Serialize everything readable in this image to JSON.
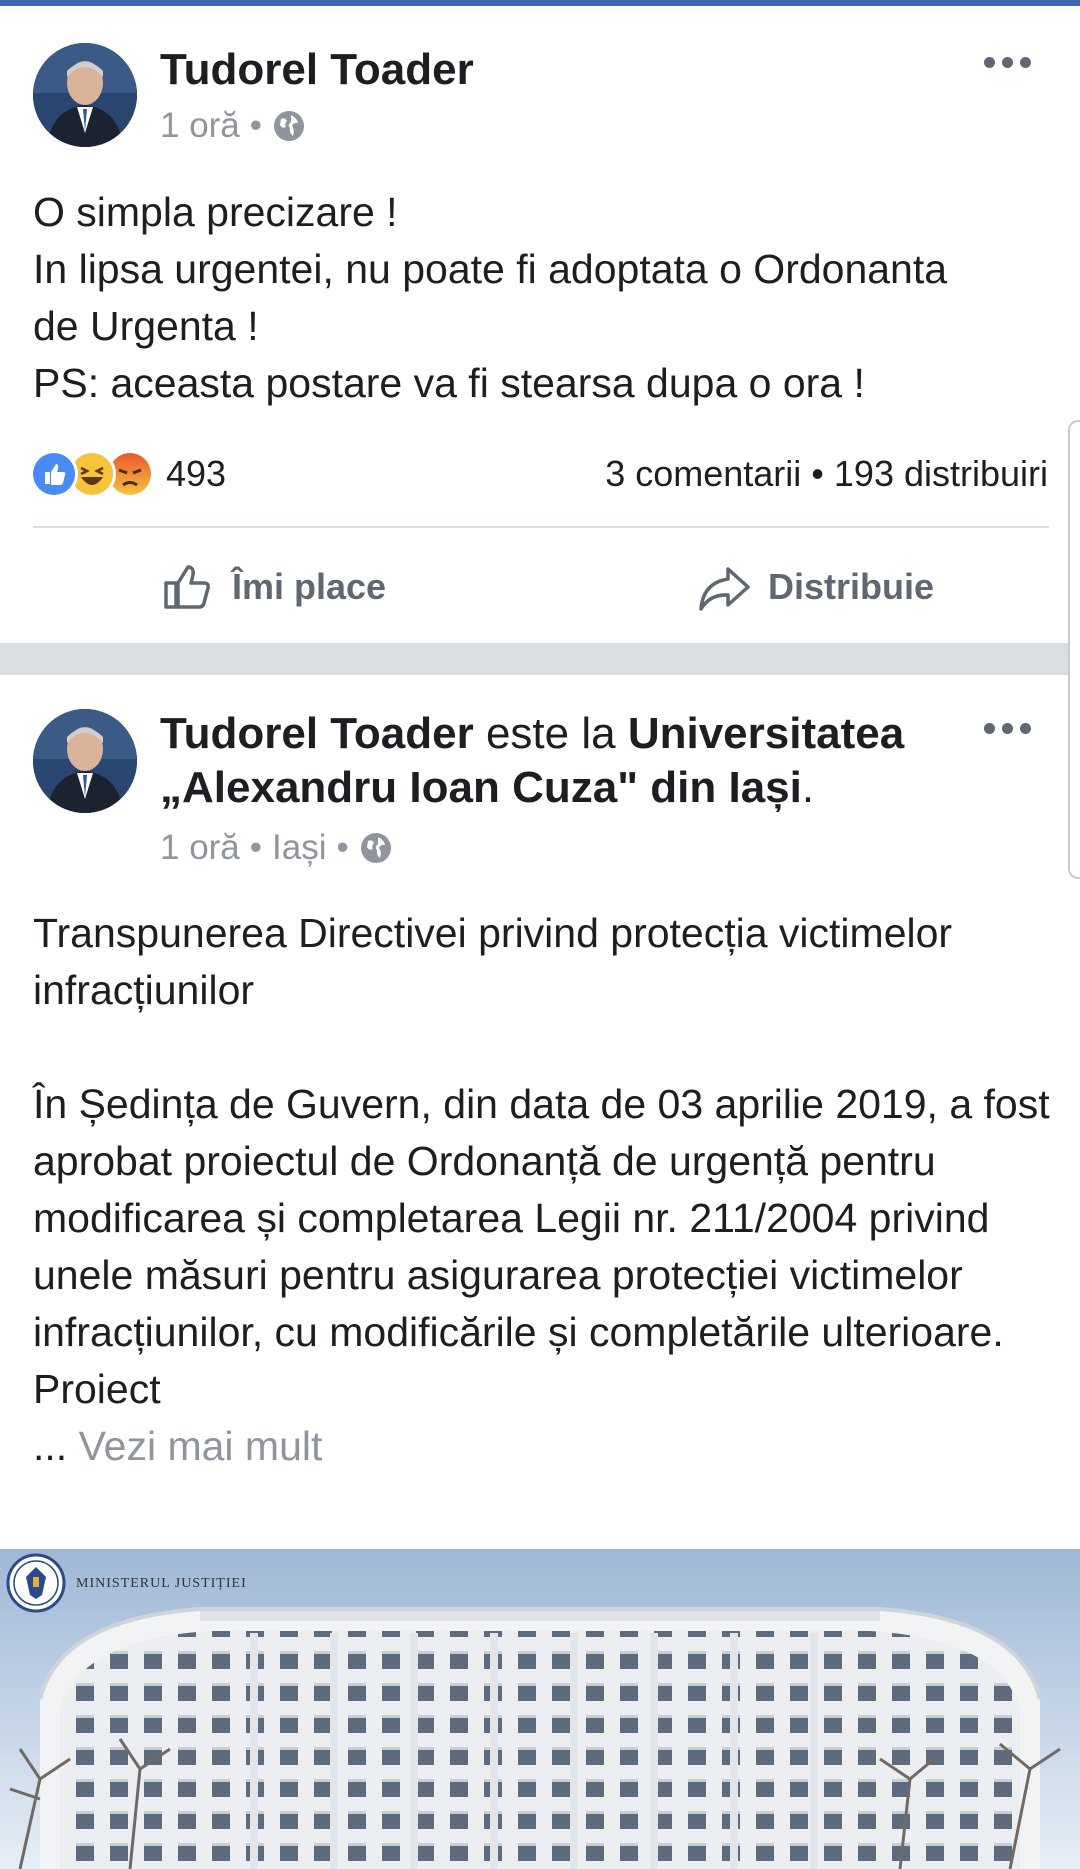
{
  "post1": {
    "author": "Tudorel Toader",
    "time": "1 oră",
    "dot": "•",
    "lines": [
      "O simpla precizare !",
      "In lipsa urgentei, nu poate fi adoptata o Ordonanta",
      "de Urgenta !",
      "PS: aceasta postare va fi stearsa dupa o ora !"
    ],
    "reaction_count": "493",
    "stats": "3 comentarii • 193 distribuiri",
    "like_label": "Îmi place",
    "share_label": "Distribuie"
  },
  "post2": {
    "author": "Tudorel Toader",
    "connector": " este la ",
    "place": "Universitatea „Alexandru Ioan Cuza\" din Iași",
    "period": ".",
    "time": "1 oră",
    "location": "Iași",
    "dot": "•",
    "paragraph1": "Transpunerea Directivei privind protecția victimelor infracțiunilor",
    "paragraph2": "În Ședința de Guvern, din data de 03 aprilie 2019, a fost aprobat proiectul de Ordonanță de urgență pentru modificarea și completarea Legii nr. 211/2004 privind unele măsuri pentru asigurarea protecției victimelor infracțiunilor, cu modificările și completările ulterioare.",
    "paragraph3": "Proiect",
    "ellipsis": "... ",
    "see_more": "Vezi mai mult",
    "image_seal_text": "GUVERNUL ROMÂNIEI",
    "image_caption": "MINISTERUL JUSTIȚIEI"
  },
  "icons": {
    "more": "more-horizontal-icon",
    "globe": "globe-icon",
    "like": "thumbs-up-icon",
    "share": "share-arrow-icon",
    "reactions": [
      "like-reaction-icon",
      "haha-reaction-icon",
      "angry-reaction-icon"
    ]
  },
  "colors": {
    "brand": "#4267b2",
    "secondary_text": "#90949c",
    "action_text": "#606770",
    "divider": "#dadde1"
  }
}
